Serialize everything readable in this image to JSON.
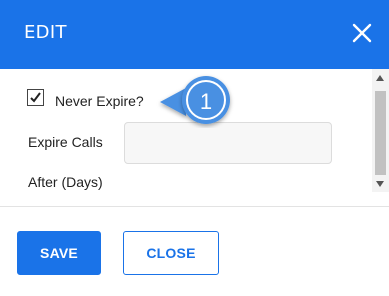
{
  "header": {
    "title": "EDIT",
    "close_icon": "close-icon"
  },
  "form": {
    "never_expire": {
      "label": "Never Expire?",
      "checked": true
    },
    "expire_calls": {
      "label_line1": "Expire Calls",
      "label_line2": "After (Days)",
      "value": "",
      "placeholder": ""
    }
  },
  "callout": {
    "number": "1"
  },
  "footer": {
    "save_label": "SAVE",
    "close_label": "CLOSE"
  },
  "colors": {
    "accent": "#1a73e8",
    "callout": "#4a90e2"
  }
}
